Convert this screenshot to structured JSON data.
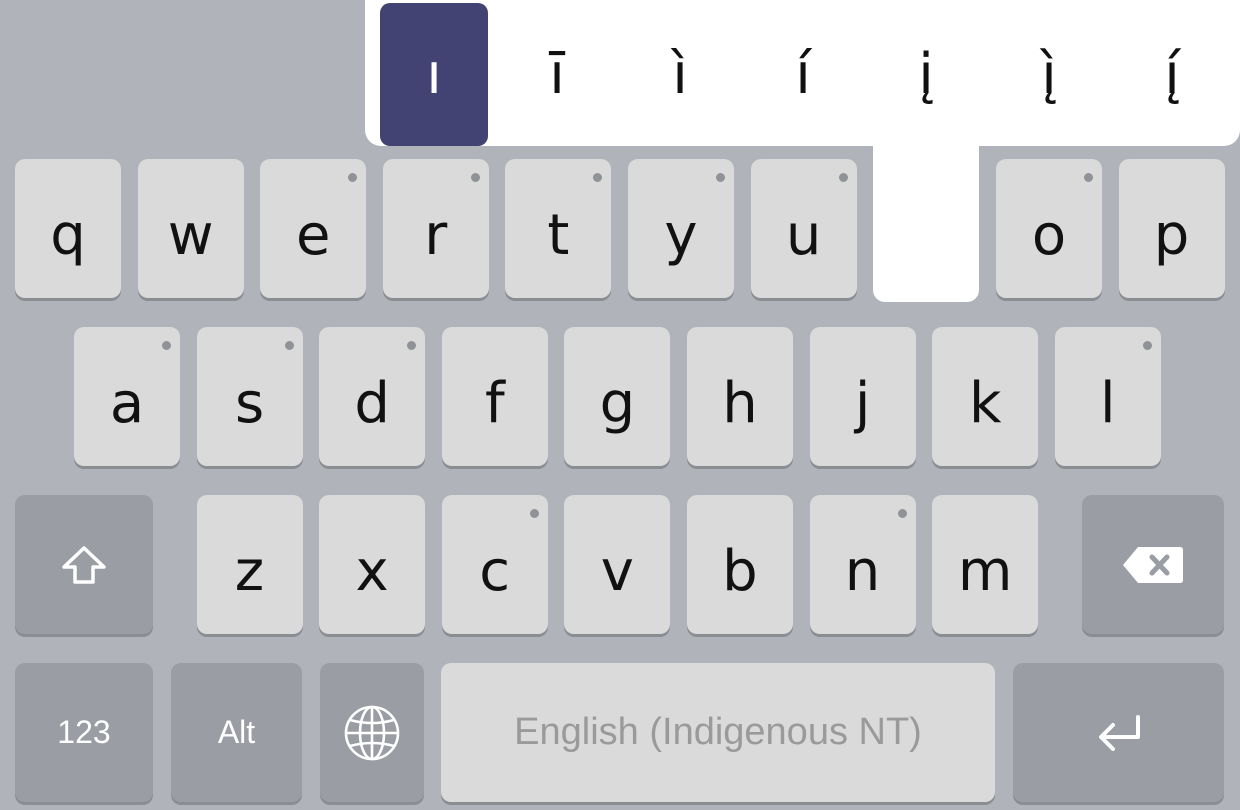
{
  "popup": {
    "alternates": [
      "ı",
      "ī",
      "ì",
      "í",
      "į",
      "į̀",
      "į́"
    ],
    "selected_index": 0
  },
  "rows": [
    [
      {
        "label": "q",
        "dot": false
      },
      {
        "label": "w",
        "dot": false
      },
      {
        "label": "e",
        "dot": true
      },
      {
        "label": "r",
        "dot": true
      },
      {
        "label": "t",
        "dot": true
      },
      {
        "label": "y",
        "dot": true
      },
      {
        "label": "u",
        "dot": true
      },
      {
        "label": "o",
        "dot": true
      },
      {
        "label": "p",
        "dot": false
      }
    ],
    [
      {
        "label": "a",
        "dot": true
      },
      {
        "label": "s",
        "dot": true
      },
      {
        "label": "d",
        "dot": true
      },
      {
        "label": "f",
        "dot": false
      },
      {
        "label": "g",
        "dot": false
      },
      {
        "label": "h",
        "dot": false
      },
      {
        "label": "j",
        "dot": false
      },
      {
        "label": "k",
        "dot": false
      },
      {
        "label": "l",
        "dot": true
      }
    ],
    [
      {
        "label": "z",
        "dot": false
      },
      {
        "label": "x",
        "dot": false
      },
      {
        "label": "c",
        "dot": true
      },
      {
        "label": "v",
        "dot": false
      },
      {
        "label": "b",
        "dot": false
      },
      {
        "label": "n",
        "dot": true
      },
      {
        "label": "m",
        "dot": false
      }
    ]
  ],
  "bottom": {
    "numbers_label": "123",
    "alt_label": "Alt",
    "space_label": "English (Indigenous NT)"
  },
  "icons": {
    "shift": "shift-icon",
    "backspace": "backspace-icon",
    "globe": "globe-icon",
    "enter": "enter-icon"
  }
}
